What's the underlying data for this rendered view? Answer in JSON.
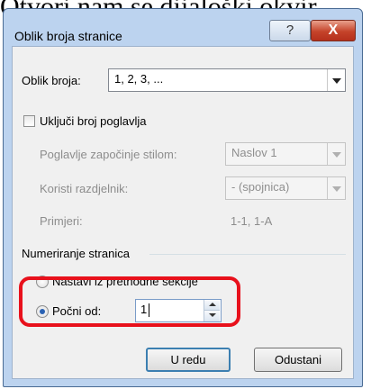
{
  "caption": "Otvori nam se dijaloški okvir",
  "dialog": {
    "title": "Oblik broja stranice",
    "help_glyph": "?",
    "close_glyph": "X"
  },
  "form": {
    "number_format_label": "Oblik broja:",
    "number_format_value": "1, 2, 3, ...",
    "include_chapter_label": "Uključi broj poglavlja",
    "chapter_style_label": "Poglavlje započinje stilom:",
    "chapter_style_value": "Naslov 1",
    "separator_label": "Koristi razdjelnik:",
    "separator_value": "-   (spojnica)",
    "examples_label": "Primjeri:",
    "examples_value": "1-1, 1-A"
  },
  "numbering": {
    "group_label": "Numeriranje stranica",
    "continue_label": "Nastavi iz prethodne sekcije",
    "start_at_label": "Počni od:",
    "start_at_value": "1"
  },
  "buttons": {
    "ok_label": "U redu",
    "cancel_label": "Odustani"
  },
  "colors": {
    "highlight": "#e8111c",
    "window_frame": "#bcd3ef"
  },
  "icons": {
    "help": "question-mark-icon",
    "close": "close-icon",
    "dropdown": "chevron-down-icon",
    "spin": "spin-arrows-icon"
  }
}
